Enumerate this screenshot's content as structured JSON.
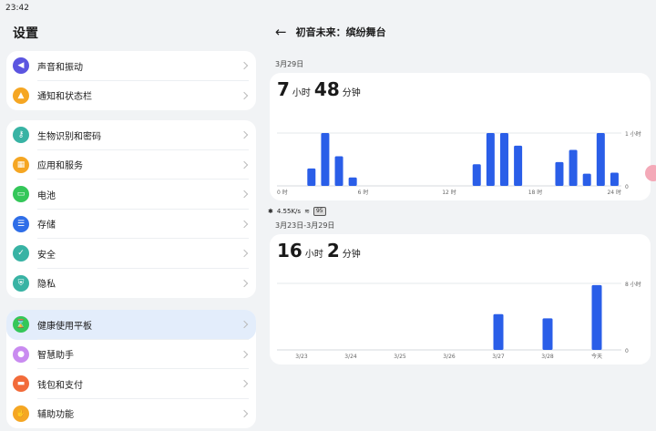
{
  "status": {
    "time": "23:42",
    "net": "4.55K/s",
    "battery": "95"
  },
  "left": {
    "title": "设置",
    "groups": [
      {
        "items": [
          {
            "label": "声音和振动",
            "icon": "speaker-icon",
            "color": "#5b55e0",
            "glyph": "◀"
          },
          {
            "label": "通知和状态栏",
            "icon": "bell-icon",
            "color": "#f5a623",
            "glyph": "▲"
          }
        ]
      },
      {
        "items": [
          {
            "label": "生物识别和密码",
            "icon": "key-icon",
            "color": "#38b3a4",
            "glyph": "⚷"
          },
          {
            "label": "应用和服务",
            "icon": "apps-icon",
            "color": "#f5a623",
            "glyph": "▦"
          },
          {
            "label": "电池",
            "icon": "battery-icon",
            "color": "#34c759",
            "glyph": "▭"
          },
          {
            "label": "存储",
            "icon": "storage-icon",
            "color": "#2f6ee8",
            "glyph": "☰"
          },
          {
            "label": "安全",
            "icon": "security-icon",
            "color": "#38b3a4",
            "glyph": "✓"
          },
          {
            "label": "隐私",
            "icon": "privacy-icon",
            "color": "#38b3a4",
            "glyph": "⛨"
          }
        ]
      },
      {
        "items": [
          {
            "label": "健康使用平板",
            "icon": "hourglass-icon",
            "color": "#34c759",
            "glyph": "⌛",
            "active": true
          },
          {
            "label": "智慧助手",
            "icon": "assistant-icon",
            "color": "#c98bf0",
            "glyph": "●"
          },
          {
            "label": "钱包和支付",
            "icon": "wallet-icon",
            "color": "#f26b3a",
            "glyph": "▬"
          },
          {
            "label": "辅助功能",
            "icon": "accessibility-icon",
            "color": "#f5a623",
            "glyph": "✋"
          }
        ]
      }
    ]
  },
  "right": {
    "title": "初音未来：缤纷舞台",
    "day": {
      "label": "3月29日",
      "hours": "7",
      "hours_unit": "小时",
      "minutes": "48",
      "minutes_unit": "分钟"
    },
    "week": {
      "label": "3月23日-3月29日",
      "hours": "16",
      "hours_unit": "小时",
      "minutes": "2",
      "minutes_unit": "分钟"
    }
  },
  "chart_data": [
    {
      "type": "bar",
      "x_ticks": [
        "0 时",
        "6 时",
        "12 时",
        "18 时",
        "24 时"
      ],
      "y_ticks": [
        "1 小时",
        "0"
      ],
      "ylim": [
        0,
        1
      ],
      "values": [
        0,
        0,
        0.33,
        1.0,
        0.56,
        0.16,
        0,
        0,
        0,
        0,
        0,
        0,
        0,
        0,
        0.41,
        1.0,
        1.0,
        0.76,
        0,
        0,
        0.45,
        0.68,
        0.23,
        1.0,
        0.25
      ]
    },
    {
      "type": "bar",
      "categories": [
        "3/23",
        "3/24",
        "3/25",
        "3/26",
        "3/27",
        "3/28",
        "今天"
      ],
      "y_ticks": [
        "8 小时",
        "0"
      ],
      "ylim": [
        0,
        8
      ],
      "values": [
        0,
        0,
        0,
        0,
        4.3,
        3.8,
        7.8
      ]
    }
  ]
}
